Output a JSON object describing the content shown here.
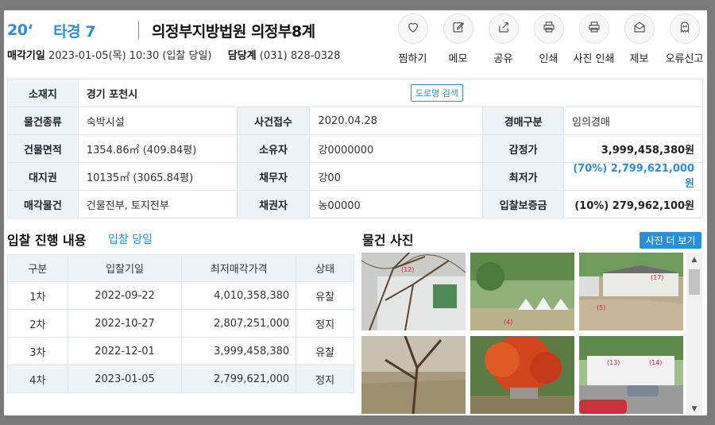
{
  "header": {
    "case_year": "20‘",
    "case_number": "타경 7",
    "court": "의정부지방법원 의정부8계",
    "auction_date_label": "매각기일",
    "auction_date": "2023-01-05(목) 10:30 (입찰 당일)",
    "manager_label": "담당계",
    "manager_phone": "(031) 828-0328"
  },
  "actions": [
    {
      "label": "찜하기",
      "icon": "heart-icon"
    },
    {
      "label": "메모",
      "icon": "memo-icon"
    },
    {
      "label": "공유",
      "icon": "share-icon"
    },
    {
      "label": "인쇄",
      "icon": "print-icon"
    },
    {
      "label": "사진 인쇄",
      "icon": "photo-print-icon"
    },
    {
      "label": "제보",
      "icon": "report-icon"
    },
    {
      "label": "오류신고",
      "icon": "ghost-icon"
    }
  ],
  "info": {
    "location_label": "소재지",
    "location_value": "경기 포천시",
    "road_search_label": "도로명 검색",
    "rows": [
      {
        "l1": "물건종류",
        "v1": "숙박시설",
        "l2": "사건접수",
        "v2": "2020.04.28",
        "l3": "경매구분",
        "v3": "임의경매"
      },
      {
        "l1": "건물면적",
        "v1": "1354.86㎡ (409.84평)",
        "l2": "소유자",
        "v2": "강0000000",
        "l3": "감정가",
        "v3": "3,999,458,380원"
      },
      {
        "l1": "대지권",
        "v1": "10135㎡ (3065.84평)",
        "l2": "채무자",
        "v2": "강00",
        "l3": "최저가",
        "v3": "(70%) 2,799,621,000원"
      },
      {
        "l1": "매각물건",
        "v1": "건물전부, 토지전부",
        "l2": "채권자",
        "v2": "농00000",
        "l3": "입찰보증금",
        "v3": "(10%) 279,962,100원"
      }
    ]
  },
  "bids": {
    "title": "입찰 진행 내용",
    "status_link": "입찰 당일",
    "headers": [
      "구분",
      "입찰기일",
      "최저매각가격",
      "상태"
    ],
    "rows": [
      {
        "round": "1차",
        "date": "2022-09-22",
        "price": "4,010,358,380",
        "status": "유찰"
      },
      {
        "round": "2차",
        "date": "2022-10-27",
        "price": "2,807,251,000",
        "status": "정지"
      },
      {
        "round": "3차",
        "date": "2022-12-01",
        "price": "3,999,458,380",
        "status": "유찰"
      },
      {
        "round": "4차",
        "date": "2023-01-05",
        "price": "2,799,621,000",
        "status": "정지"
      }
    ]
  },
  "photos": {
    "title": "물건 사진",
    "more_label": "사진 더 보기",
    "items": [
      {
        "tag": "(12)"
      },
      {
        "tag": "(4)"
      },
      {
        "tag": "(5)",
        "tag2": "(17)"
      },
      {
        "tag": ""
      },
      {
        "tag": ""
      },
      {
        "tag": "(13)",
        "tag2": "(14)"
      }
    ]
  },
  "colors": {
    "accent": "#2a8fd6",
    "header_cell": "#eef3f8"
  }
}
